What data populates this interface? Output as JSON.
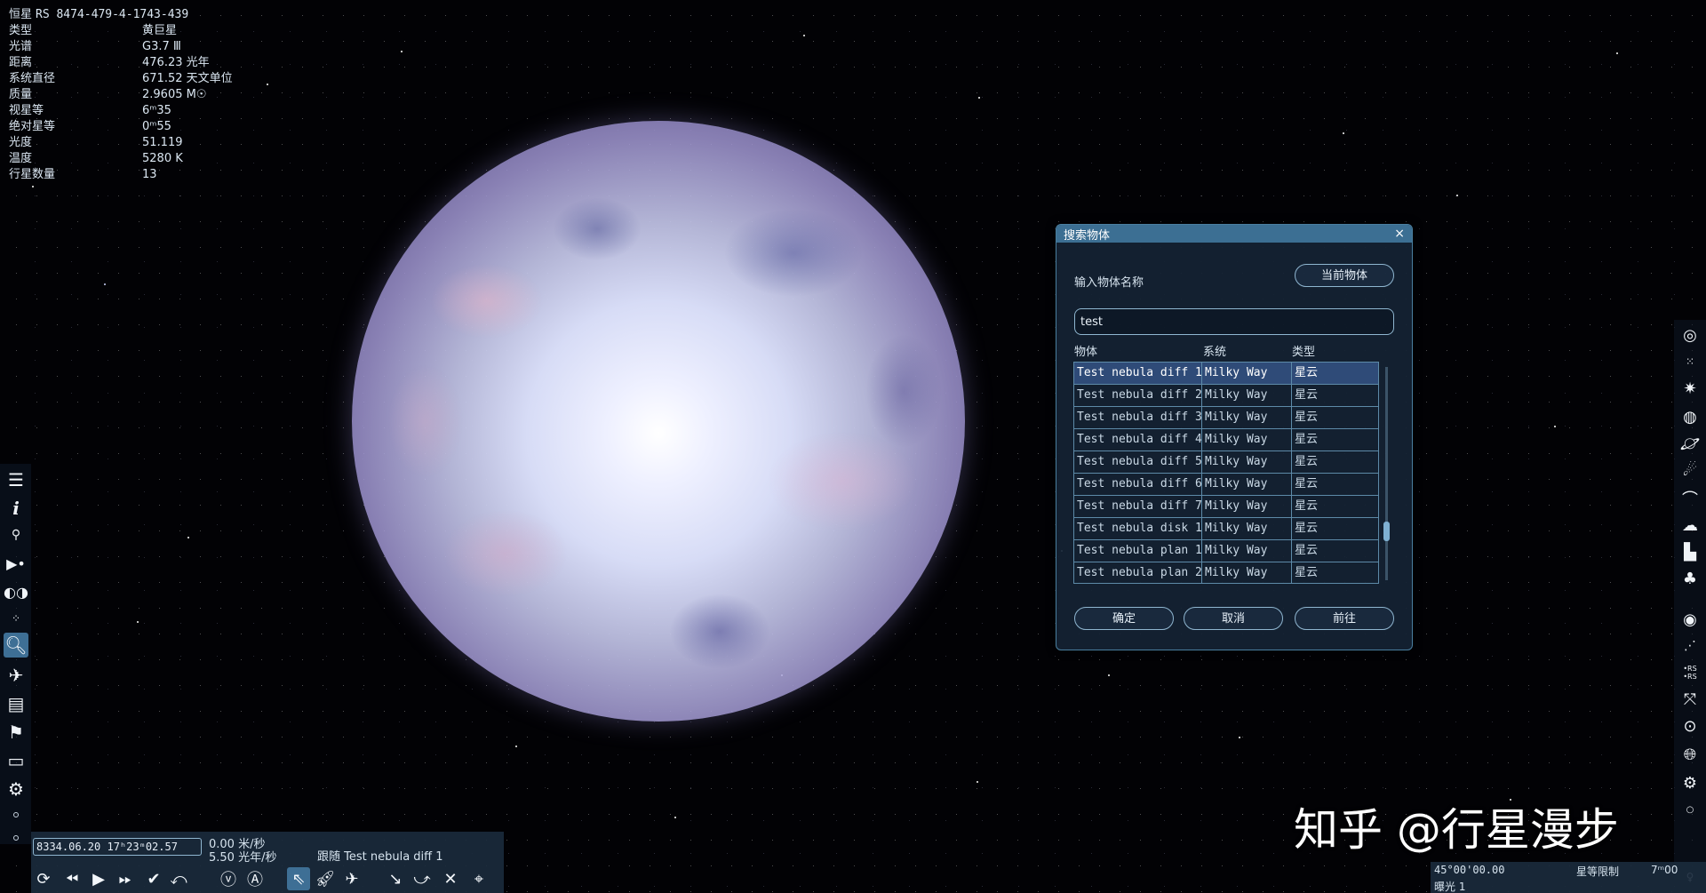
{
  "star_info": {
    "title_label": "恒星",
    "title_value": "RS 8474-479-4-1743-439",
    "rows": [
      {
        "label": "类型",
        "value": "黄巨星"
      },
      {
        "label": "光谱",
        "value": "G3.7 Ⅲ"
      },
      {
        "label": "距离",
        "value": "476.23 光年"
      },
      {
        "label": "系统直径",
        "value": "671.52 天文单位"
      },
      {
        "label": "质量",
        "value": "2.9605 M☉"
      },
      {
        "label": "视星等",
        "value": "6ᵐ35"
      },
      {
        "label": "绝对星等",
        "value": "0ᵐ55"
      },
      {
        "label": "光度",
        "value": "51.119"
      },
      {
        "label": "温度",
        "value": "5280 K"
      },
      {
        "label": "行星数量",
        "value": "13"
      }
    ]
  },
  "search_dialog": {
    "title": "搜索物体",
    "close_icon": "×",
    "name_label": "输入物体名称",
    "current_object_button": "当前物体",
    "search_value": "test",
    "columns": [
      "物体",
      "系统",
      "类型"
    ],
    "results": [
      {
        "object": "Test nebula diff 1",
        "system": "Milky Way",
        "type": "星云"
      },
      {
        "object": "Test nebula diff 2",
        "system": "Milky Way",
        "type": "星云"
      },
      {
        "object": "Test nebula diff 3",
        "system": "Milky Way",
        "type": "星云"
      },
      {
        "object": "Test nebula diff 4",
        "system": "Milky Way",
        "type": "星云"
      },
      {
        "object": "Test nebula diff 5",
        "system": "Milky Way",
        "type": "星云"
      },
      {
        "object": "Test nebula diff 6",
        "system": "Milky Way",
        "type": "星云"
      },
      {
        "object": "Test nebula diff 7",
        "system": "Milky Way",
        "type": "星云"
      },
      {
        "object": "Test nebula disk 1",
        "system": "Milky Way",
        "type": "星云"
      },
      {
        "object": "Test nebula plan 1",
        "system": "Milky Way",
        "type": "星云"
      },
      {
        "object": "Test nebula plan 2",
        "system": "Milky Way",
        "type": "星云"
      }
    ],
    "ok_button": "确定",
    "cancel_button": "取消",
    "goto_button": "前往"
  },
  "time_panel": {
    "datetime": "8334.06.20 17ʰ23ᵐ02.57",
    "speed1": "0.00 米/秒",
    "speed2": "5.50 光年/秒",
    "follow": "跟随 Test nebula diff 1"
  },
  "status_bar": {
    "coord": "45°00'00.00",
    "exposure": "曝光 1",
    "mag_limit_label": "星等限制",
    "mag_limit_value": "7ᵐ00"
  },
  "watermark": "知乎 @行星漫步"
}
